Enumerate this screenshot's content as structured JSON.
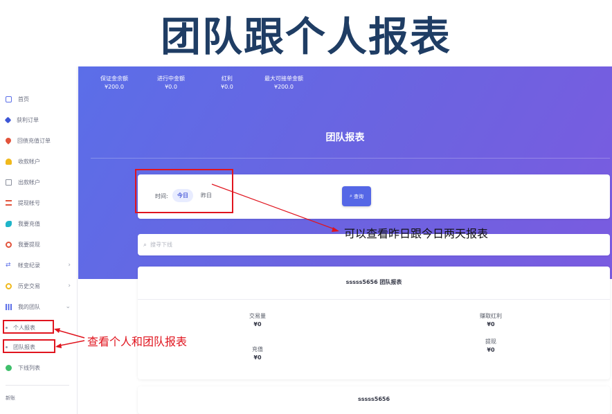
{
  "slide": {
    "title": "团队跟个人报表"
  },
  "sidebar": {
    "items": [
      {
        "label": "首页",
        "icon": "monitor-icon",
        "color": "#5b6ee8"
      },
      {
        "label": "获利订单",
        "icon": "tag-icon",
        "color": "#3d56d6"
      },
      {
        "label": "回债充值订单",
        "icon": "pin-icon",
        "color": "#e2533b"
      },
      {
        "label": "收款帐户",
        "icon": "user-icon",
        "color": "#f0b91c"
      },
      {
        "label": "出款帐户",
        "icon": "card-icon",
        "color": "#8a8f9c"
      },
      {
        "label": "提现帐号",
        "icon": "list-icon",
        "color": "#e2533b"
      },
      {
        "label": "我要充值",
        "icon": "tool-icon",
        "color": "#1fb5c9"
      },
      {
        "label": "我要提现",
        "icon": "wallet-icon",
        "color": "#e2533b"
      },
      {
        "label": "帐变纪录",
        "icon": "swap-icon",
        "color": "#5b6ee8",
        "arrow": "›"
      },
      {
        "label": "历史交易",
        "icon": "history-icon",
        "color": "#f0b91c",
        "arrow": "›"
      },
      {
        "label": "我的团队",
        "icon": "bar-chart-icon",
        "color": "#5b6ee8",
        "arrow": "⌄"
      },
      {
        "label": "个人报表",
        "sub": true
      },
      {
        "label": "团队报表",
        "sub": true
      },
      {
        "label": "下线列表",
        "icon": "team-icon",
        "color": "#3fbf6b"
      }
    ],
    "footer": "新账"
  },
  "stats": [
    {
      "label": "保证金余额",
      "value": "¥200.0"
    },
    {
      "label": "进行中金额",
      "value": "¥0.0"
    },
    {
      "label": "红利",
      "value": "¥0.0"
    },
    {
      "label": "最大可接单金额",
      "value": "¥200.0"
    }
  ],
  "banner": {
    "title": "团队报表"
  },
  "filter": {
    "label": "时间:",
    "options": [
      "今日",
      "昨日"
    ],
    "selected": "今日",
    "button": "查询"
  },
  "search": {
    "placeholder": "搜寻下线",
    "value": ""
  },
  "report": {
    "title": "sssss5656   团队报表",
    "metrics": [
      {
        "label": "交易量",
        "value": "¥0"
      },
      {
        "label": "赚取红利",
        "value": "¥0"
      },
      {
        "label": "充值",
        "value": "¥0"
      },
      {
        "label": "提现",
        "value": "¥0"
      }
    ]
  },
  "report2": {
    "title": "sssss5656"
  },
  "annotations": {
    "filter_note": "可以查看昨日跟今日两天报表",
    "sidebar_note": "查看个人和团队报表",
    "color": "#e0141e"
  },
  "theme": {
    "accent": "#5567e6",
    "banner_start": "#5b6ee8",
    "banner_end": "#7a5be0"
  }
}
